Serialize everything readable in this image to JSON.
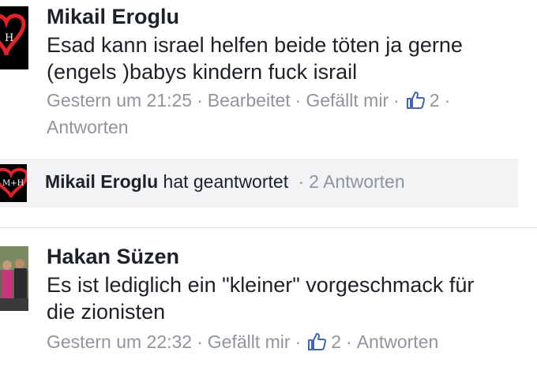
{
  "comment1": {
    "author": "Mikail Eroglu",
    "text_line1": "Esad kann israel helfen beide töten ja gerne",
    "text_line2": "(engels )babys kindern fuck israil",
    "time": "Gestern um 21:25",
    "edited": "Bearbeitet",
    "like_action": "Gefällt mir",
    "like_count": "2",
    "reply_action": "Antworten",
    "avatar_text": "H"
  },
  "reply_summary": {
    "author": "Mikail Eroglu",
    "action": "hat geantwortet",
    "count_text": "2 Antworten",
    "avatar_text": "M+H"
  },
  "comment2": {
    "author": "Hakan Süzen",
    "text_line1": "Es ist lediglich ein \"kleiner\" vorgeschmack für",
    "text_line2": "die zionisten",
    "time": "Gestern um 22:32",
    "like_action": "Gefällt mir",
    "like_count": "2",
    "reply_action": "Antworten"
  },
  "colors": {
    "link_meta": "#90949c",
    "like_blue": "#4267b2",
    "reply_bg": "#f2f3f5",
    "heart_red": "#e0222a"
  },
  "icons": [
    "heart-avatar-icon",
    "thumbs-up-icon",
    "photo-avatar"
  ]
}
